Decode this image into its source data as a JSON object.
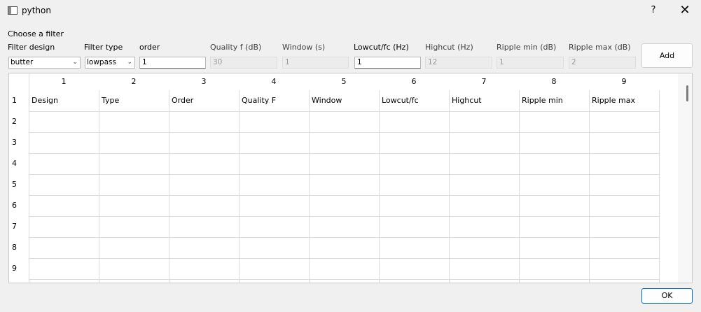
{
  "window": {
    "title": "python",
    "help_label": "?",
    "close_label": "✕"
  },
  "section_label": "Choose a filter",
  "controls": {
    "filter_design": {
      "label": "Filter design",
      "value": "butter"
    },
    "filter_type": {
      "label": "Filter type",
      "value": "lowpass"
    },
    "order": {
      "label": "order",
      "value": "1"
    },
    "quality": {
      "label": "Quality f (dB)",
      "value": "30"
    },
    "window": {
      "label": "Window (s)",
      "value": "1"
    },
    "lowcut": {
      "label": "Lowcut/fc (Hz)",
      "value": "1"
    },
    "highcut": {
      "label": "Highcut (Hz)",
      "value": "12"
    },
    "ripple_min": {
      "label": "Ripple min (dB)",
      "value": "1"
    },
    "ripple_max": {
      "label": "Ripple max (dB)",
      "value": "2"
    }
  },
  "add_button": "Add",
  "table": {
    "column_headers": [
      "1",
      "2",
      "3",
      "4",
      "5",
      "6",
      "7",
      "8",
      "9"
    ],
    "row_headers": [
      "1",
      "2",
      "3",
      "4",
      "5",
      "6",
      "7",
      "8",
      "9"
    ],
    "row1": [
      "Design",
      "Type",
      "Order",
      "Quality F",
      "Window",
      "Lowcut/fc",
      "Highcut",
      "Ripple min",
      "Ripple max"
    ]
  },
  "ok_button": "OK",
  "icons": {
    "app": "window-app-icon",
    "combo_arrow": "chevron-down-icon"
  }
}
